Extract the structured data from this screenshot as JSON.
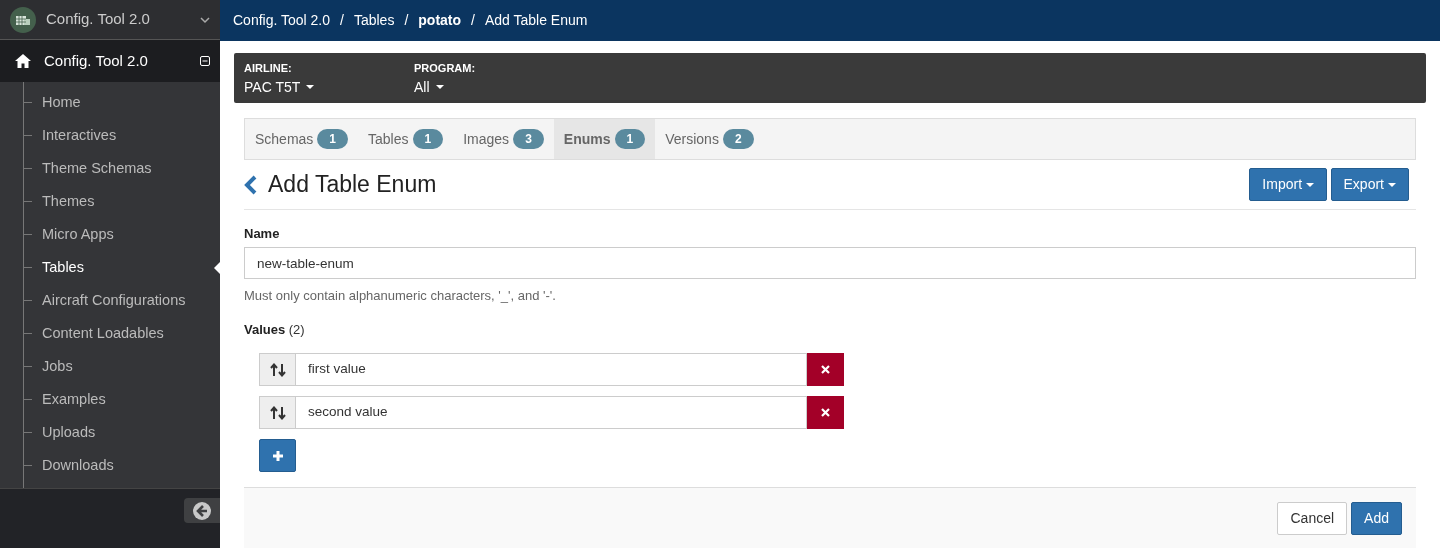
{
  "app_switcher": {
    "title": "Config. Tool 2.0"
  },
  "sidebar": {
    "root": {
      "label": "Config. Tool 2.0",
      "expanded": true
    },
    "items": [
      {
        "label": "Home",
        "selected": false
      },
      {
        "label": "Interactives",
        "selected": false
      },
      {
        "label": "Theme Schemas",
        "selected": false
      },
      {
        "label": "Themes",
        "selected": false
      },
      {
        "label": "Micro Apps",
        "selected": false
      },
      {
        "label": "Tables",
        "selected": true
      },
      {
        "label": "Aircraft Configurations",
        "selected": false
      },
      {
        "label": "Content Loadables",
        "selected": false
      },
      {
        "label": "Jobs",
        "selected": false
      },
      {
        "label": "Examples",
        "selected": false
      },
      {
        "label": "Uploads",
        "selected": false
      },
      {
        "label": "Downloads",
        "selected": false
      }
    ]
  },
  "breadcrumb": {
    "separator": "/",
    "items": [
      {
        "label": "Config. Tool 2.0",
        "bold": false
      },
      {
        "label": "Tables",
        "bold": false
      },
      {
        "label": "potato",
        "bold": true
      },
      {
        "label": "Add Table Enum",
        "bold": false
      }
    ]
  },
  "filters": [
    {
      "label": "AIRLINE:",
      "value": "PAC T5T"
    },
    {
      "label": "PROGRAM:",
      "value": "All"
    }
  ],
  "tabs": [
    {
      "label": "Schemas",
      "count": "1",
      "selected": false
    },
    {
      "label": "Tables",
      "count": "1",
      "selected": false
    },
    {
      "label": "Images",
      "count": "3",
      "selected": false
    },
    {
      "label": "Enums",
      "count": "1",
      "selected": true
    },
    {
      "label": "Versions",
      "count": "2",
      "selected": false
    }
  ],
  "page_title": "Add Table Enum",
  "header_buttons": [
    "Import",
    "Export"
  ],
  "form": {
    "name_label": "Name",
    "name_value": "new-table-enum",
    "help": "Must only contain alphanumeric characters, '_', and '-'.",
    "values_label": "Values",
    "values_count": "(2)",
    "values": [
      "first value",
      "second value"
    ]
  },
  "footer_buttons": [
    {
      "label": "Cancel",
      "kind": "secondary"
    },
    {
      "label": "Add",
      "kind": "primary"
    }
  ]
}
